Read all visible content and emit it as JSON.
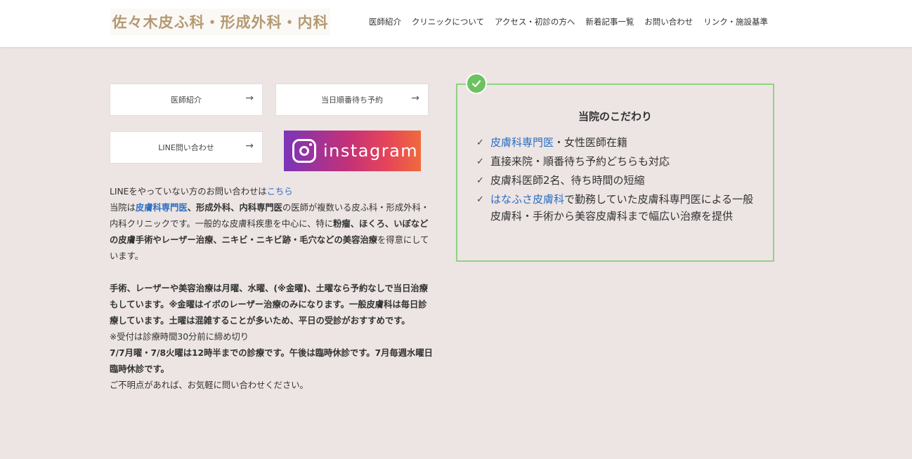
{
  "header": {
    "logo_text": "佐々木皮ふ科・形成外科・内科",
    "nav": [
      "医師紹介",
      "クリニックについて",
      "アクセス・初診の方へ",
      "新着記事一覧",
      "お問い合わせ",
      "リンク・施設基準"
    ]
  },
  "buttons": {
    "doctor": "医師紹介",
    "reservation": "当日順番待ち予約",
    "line": "LINE問い合わせ",
    "arrow": "→"
  },
  "instagram": {
    "label": "instagram"
  },
  "body_text": {
    "line_prefix": "LINEをやっていない方のお問い合わせは",
    "line_link": "こちら",
    "p1_a": "当院は",
    "p1_b": "皮膚科専門医",
    "p1_c": "、形成外科、内科専門医",
    "p1_d": "の医師が複数いる皮ふ科・形成外科・内科クリニックです。一般的な皮膚科疾患を中心に、特に",
    "p1_e": "粉瘤、ほくろ、いぼなどの皮膚手術やレーザー治療、ニキビ・ニキビ跡・毛穴などの美容治療",
    "p1_f": "を得意にしています。",
    "p2": "手術、レーザーや美容治療は月曜、水曜、(※金曜)、土曜なら予約なしで当日治療もしています。※金曜はイボのレーザー治療のみになります。一般皮膚科は毎日診療しています。土曜は混雑することが多いため、平日の受診がおすすめです。",
    "p3": "※受付は診療時間30分前に締め切り",
    "p4": "7/7月曜・7/8火曜は12時半までの診療です。午後は臨時休診です。7月毎週水曜日臨時休診です。",
    "p5": "ご不明点があれば、お気軽に問い合わせください。"
  },
  "features": {
    "title": "当院のこだわり",
    "items": [
      {
        "link": "皮膚科専門医",
        "text": "・女性医師在籍"
      },
      {
        "link": "",
        "text": "直接来院・順番待ち予約どちらも対応"
      },
      {
        "link": "",
        "text": "皮膚科医師2名、待ち時間の短縮"
      },
      {
        "link": "はなふさ皮膚科",
        "text": "で勤務していた皮膚科専門医による一般皮膚科・手術から美容皮膚科まで幅広い治療を提供"
      }
    ]
  },
  "colors": {
    "background": "#ede4e4",
    "accent_blue": "#2b6fc1",
    "box_border": "#8fd383",
    "check_green": "#6cc25f",
    "logo": "#b49a74"
  }
}
